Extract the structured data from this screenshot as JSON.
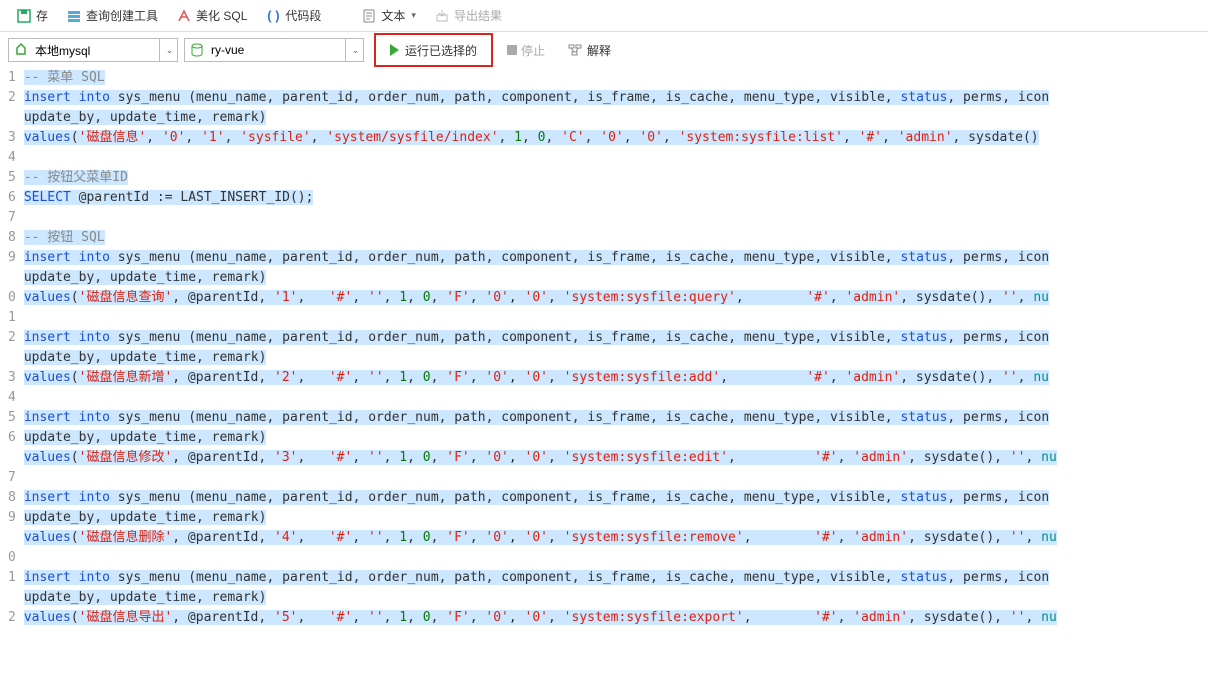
{
  "toolbar": {
    "save": "存",
    "queryBuilder": "查询创建工具",
    "beautify": "美化 SQL",
    "codeSnippet": "代码段",
    "text": "文本",
    "export": "导出结果"
  },
  "params": {
    "connection": "本地mysql",
    "database": "ry-vue",
    "run": "运行已选择的",
    "stop": "停止",
    "explain": "解释"
  },
  "lineNumbers": [
    "1",
    "2",
    "",
    "3",
    "4",
    "5",
    "6",
    "7",
    "8",
    "9",
    "",
    "0",
    "1",
    "2",
    "",
    "3",
    "4",
    "5",
    "6",
    "",
    "7",
    "8",
    "9",
    "",
    "0",
    "1",
    "",
    "2"
  ],
  "code": {
    "comment1": "-- 菜单 SQL",
    "insert": "insert",
    "into": "into",
    "table": "sys_menu (menu_name, parent_id, order_num, path, component, is_frame, is_cache, menu_type, visible, ",
    "status": "status",
    "tail": ", perms, icon",
    "line2b": "update_by, update_time, remark)",
    "values": "values",
    "v1a": "'磁盘信息'",
    "v1b": "'0'",
    "v1c": "'1'",
    "v1d": "'sysfile'",
    "v1e": "'system/sysfile/index'",
    "v1num1": "1",
    "v1num0": "0",
    "v1f": "'C'",
    "v1g": "'0'",
    "v1h": "'0'",
    "v1i": "'system:sysfile:list'",
    "v1j": "'#'",
    "v1k": "'admin'",
    "sysdate": "sysdate()",
    "comment2": "-- 按钮父菜单ID",
    "select": "SELECT",
    "selectRest": " @parentId := LAST_INSERT_ID();",
    "comment3": "-- 按钮 SQL",
    "v2a": "'磁盘信息查询'",
    "parentId": "@parentId",
    "v2c": "'1'",
    "hash": "'#'",
    "empty": "''",
    "fChar": "'F'",
    "zero": "'0'",
    "perm2": "'system:sysfile:query'",
    "admin": "'admin'",
    "nu": "nu",
    "v3a": "'磁盘信息新增'",
    "v3c": "'2'",
    "perm3": "'system:sysfile:add'",
    "v4a": "'磁盘信息修改'",
    "v4c": "'3'",
    "perm4": "'system:sysfile:edit'",
    "v5a": "'磁盘信息删除'",
    "v5c": "'4'",
    "perm5": "'system:sysfile:remove'",
    "v6a": "'磁盘信息导出'",
    "v6c": "'5'",
    "perm6": "'system:sysfile:export'",
    "comma": ", ",
    "openParen": "("
  }
}
